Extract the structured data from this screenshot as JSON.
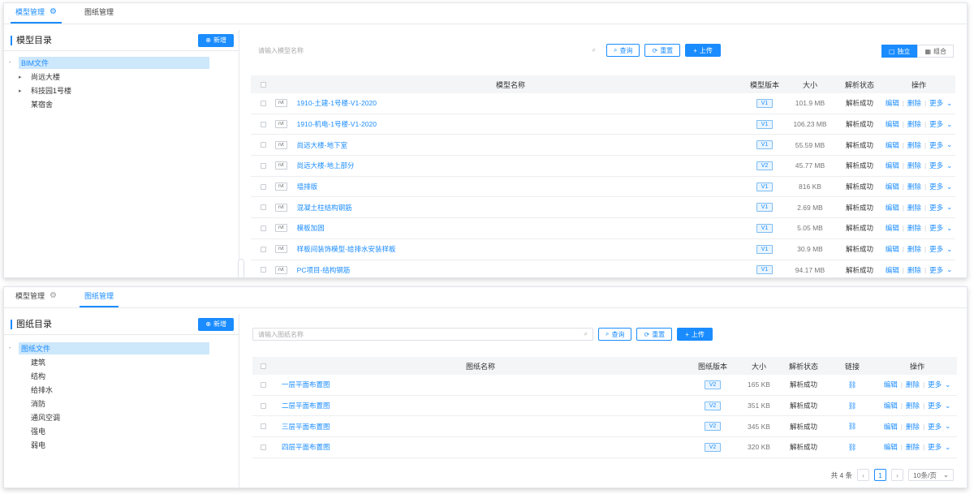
{
  "colors": {
    "accent": "#1a8cff",
    "selected_bg": "#cde7fb",
    "tag_bg": "#eaf5ff"
  },
  "top": {
    "tabs": [
      {
        "label": "模型管理",
        "icon": "gear-icon"
      },
      {
        "label": "图纸管理"
      }
    ],
    "left": {
      "title": "模型目录",
      "add_label": "新增",
      "tree": [
        {
          "label": "BIM文件",
          "selected": true,
          "expand": "-"
        },
        {
          "label": "尚远大楼",
          "expand": "▸"
        },
        {
          "label": "科技园1号楼",
          "expand": "▸"
        },
        {
          "label": "某宿舍"
        }
      ]
    },
    "toolbar": {
      "search_placeholder": "请输入模型名称",
      "search_btn": "查询",
      "reset_btn": "重置",
      "upload_btn": "上传",
      "view_independent": "独立",
      "view_combined": "组合"
    },
    "table": {
      "headers": {
        "name": "模型名称",
        "version": "模型版本",
        "size": "大小",
        "status": "解析状态",
        "ops": "操作"
      },
      "ops": {
        "edit": "编辑",
        "delete": "删除",
        "more": "更多"
      },
      "rows": [
        {
          "type": "rvt",
          "name": "1910-土建-1号楼-V1-2020",
          "version": "V1",
          "size": "101.9 MB",
          "status": "解析成功"
        },
        {
          "type": "rvt",
          "name": "1910-机电-1号楼-V1-2020",
          "version": "V1",
          "size": "106.23 MB",
          "status": "解析成功"
        },
        {
          "type": "rvt",
          "name": "尚远大楼-地下室",
          "version": "V1",
          "size": "55.59 MB",
          "status": "解析成功"
        },
        {
          "type": "rvt",
          "name": "尚远大楼-地上部分",
          "version": "V2",
          "size": "45.77 MB",
          "status": "解析成功"
        },
        {
          "type": "rvt",
          "name": "墙排版",
          "version": "V1",
          "size": "816 KB",
          "status": "解析成功"
        },
        {
          "type": "rvt",
          "name": "混凝土柱结构钢筋",
          "version": "V1",
          "size": "2.69 MB",
          "status": "解析成功"
        },
        {
          "type": "rvt",
          "name": "模板加固",
          "version": "V1",
          "size": "5.05 MB",
          "status": "解析成功"
        },
        {
          "type": "rvt",
          "name": "样板间装饰模型-给排水安装样板",
          "version": "V1",
          "size": "30.9 MB",
          "status": "解析成功"
        },
        {
          "type": "rvt",
          "name": "PC项目-结构钢筋",
          "version": "V1",
          "size": "94.17 MB",
          "status": "解析成功"
        }
      ]
    }
  },
  "bottom": {
    "tabs": [
      {
        "label": "模型管理",
        "icon": "gear-icon"
      },
      {
        "label": "图纸管理"
      }
    ],
    "left": {
      "title": "图纸目录",
      "add_label": "新增",
      "tree": [
        {
          "label": "图纸文件",
          "selected": true,
          "expand": "-"
        },
        {
          "label": "建筑"
        },
        {
          "label": "结构"
        },
        {
          "label": "给排水"
        },
        {
          "label": "消防"
        },
        {
          "label": "通风空调"
        },
        {
          "label": "强电"
        },
        {
          "label": "弱电"
        }
      ]
    },
    "toolbar": {
      "search_placeholder": "请输入图纸名称",
      "search_btn": "查询",
      "reset_btn": "重置",
      "upload_btn": "上传"
    },
    "table": {
      "headers": {
        "name": "图纸名称",
        "version": "图纸版本",
        "size": "大小",
        "status": "解析状态",
        "link": "链接",
        "ops": "操作"
      },
      "ops": {
        "edit": "编辑",
        "delete": "删除",
        "more": "更多"
      },
      "rows": [
        {
          "name": "一层平面布置图",
          "version": "V2",
          "size": "165 KB",
          "status": "解析成功"
        },
        {
          "name": "二层平面布置图",
          "version": "V2",
          "size": "351 KB",
          "status": "解析成功"
        },
        {
          "name": "三层平面布置图",
          "version": "V2",
          "size": "345 KB",
          "status": "解析成功"
        },
        {
          "name": "四层平面布置图",
          "version": "V2",
          "size": "320 KB",
          "status": "解析成功"
        }
      ]
    },
    "pager": {
      "total": "共 4 条",
      "current": "1",
      "page_size": "10条/页"
    }
  }
}
